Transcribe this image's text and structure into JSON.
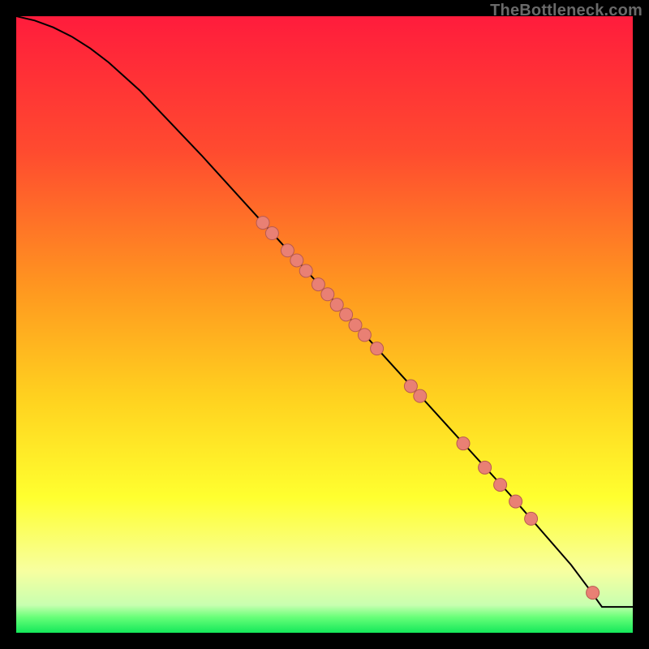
{
  "watermark": "TheBottleneck.com",
  "colors": {
    "gradient_stops": [
      {
        "offset": 0.0,
        "color": "#ff1c3c"
      },
      {
        "offset": 0.22,
        "color": "#ff4b2f"
      },
      {
        "offset": 0.45,
        "color": "#ff9a1f"
      },
      {
        "offset": 0.62,
        "color": "#ffd21f"
      },
      {
        "offset": 0.78,
        "color": "#ffff2f"
      },
      {
        "offset": 0.9,
        "color": "#f7ffa0"
      },
      {
        "offset": 0.955,
        "color": "#c8ffb0"
      },
      {
        "offset": 0.975,
        "color": "#67ff78"
      },
      {
        "offset": 1.0,
        "color": "#14e85a"
      }
    ],
    "curve": "#000000",
    "point_fill": "#e98074",
    "point_stroke": "#b85a50"
  },
  "chart_data": {
    "type": "line",
    "title": "",
    "xlabel": "",
    "ylabel": "",
    "xlim": [
      0,
      100
    ],
    "ylim": [
      0,
      100
    ],
    "series": [
      {
        "name": "curve",
        "x": [
          0,
          3,
          6,
          9,
          12,
          15,
          20,
          30,
          40,
          50,
          60,
          70,
          80,
          90,
          93,
          95,
          100
        ],
        "y": [
          100,
          99.3,
          98.2,
          96.7,
          94.8,
          92.5,
          88.0,
          77.5,
          66.5,
          55.5,
          44.5,
          33.5,
          22.5,
          11.0,
          7.0,
          4.2,
          4.2
        ]
      }
    ],
    "scatter_points": [
      {
        "x": 40.0,
        "y": 66.5
      },
      {
        "x": 41.5,
        "y": 64.8
      },
      {
        "x": 44.0,
        "y": 62.0
      },
      {
        "x": 45.5,
        "y": 60.4
      },
      {
        "x": 47.0,
        "y": 58.7
      },
      {
        "x": 49.0,
        "y": 56.5
      },
      {
        "x": 50.5,
        "y": 54.9
      },
      {
        "x": 52.0,
        "y": 53.2
      },
      {
        "x": 53.5,
        "y": 51.6
      },
      {
        "x": 55.0,
        "y": 49.9
      },
      {
        "x": 56.5,
        "y": 48.3
      },
      {
        "x": 58.5,
        "y": 46.1
      },
      {
        "x": 64.0,
        "y": 40.0
      },
      {
        "x": 65.5,
        "y": 38.4
      },
      {
        "x": 72.5,
        "y": 30.7
      },
      {
        "x": 76.0,
        "y": 26.8
      },
      {
        "x": 78.5,
        "y": 24.0
      },
      {
        "x": 81.0,
        "y": 21.3
      },
      {
        "x": 83.5,
        "y": 18.5
      },
      {
        "x": 93.5,
        "y": 6.5
      }
    ],
    "point_radius": 8
  }
}
